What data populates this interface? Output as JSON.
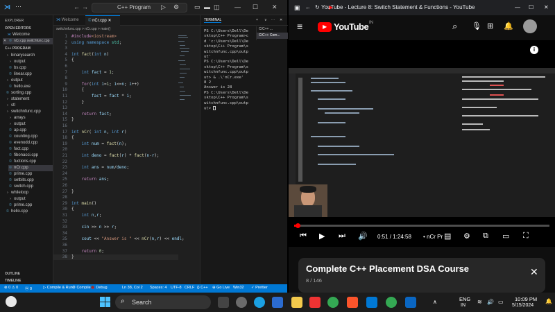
{
  "vscode": {
    "title": "C++ Program",
    "explorer": {
      "header": "EXPLORER",
      "open_editors": "OPEN EDITORS",
      "open_items": [
        "Welcome",
        "nCr.cpp switchfunc.cpp"
      ],
      "folder": "C++ PROGRAM",
      "items": [
        {
          "label": "binarysearch",
          "kind": "folder"
        },
        {
          "label": "output",
          "kind": "folder"
        },
        {
          "label": "bs.cpp",
          "kind": "file"
        },
        {
          "label": "linear.cpp",
          "kind": "file"
        },
        {
          "label": "output",
          "kind": "folder"
        },
        {
          "label": "hello.exe",
          "kind": "file"
        },
        {
          "label": "sorting.cpp",
          "kind": "file"
        },
        {
          "label": "statement",
          "kind": "folder"
        },
        {
          "label": "stl",
          "kind": "folder"
        },
        {
          "label": "switchnfunc.cpp",
          "kind": "folder"
        },
        {
          "label": "arrays",
          "kind": "folder"
        },
        {
          "label": "output",
          "kind": "folder"
        },
        {
          "label": "ap.cpp",
          "kind": "file"
        },
        {
          "label": "counting.cpp",
          "kind": "file"
        },
        {
          "label": "evenodd.cpp",
          "kind": "file"
        },
        {
          "label": "fact.cpp",
          "kind": "file"
        },
        {
          "label": "fibonacci.cpp",
          "kind": "file"
        },
        {
          "label": "fuctions.cpp",
          "kind": "file"
        },
        {
          "label": "nCr.cpp",
          "kind": "file"
        },
        {
          "label": "prime.cpp",
          "kind": "file"
        },
        {
          "label": "setbits.cpp",
          "kind": "file"
        },
        {
          "label": "switch.cpp",
          "kind": "file"
        },
        {
          "label": "whileloop",
          "kind": "folder"
        },
        {
          "label": "output",
          "kind": "folder"
        },
        {
          "label": "prime.cpp",
          "kind": "file"
        },
        {
          "label": "hello.cpp",
          "kind": "file"
        }
      ],
      "outline": "OUTLINE",
      "timeline": "TIMELINE"
    },
    "tabs": [
      "Welcome",
      "nCr.cpp"
    ],
    "breadcrumb": "switchnfunc.cpp  >  nCr.cpp  >  main()",
    "code": [
      [
        [
          "pp",
          "#include"
        ],
        [
          "st",
          "<iostream>"
        ]
      ],
      [
        [
          "kw",
          "using namespace "
        ],
        [
          "ty",
          "std"
        ],
        [
          "tx",
          ";"
        ]
      ],
      [],
      [
        [
          "kw",
          "int "
        ],
        [
          "fn",
          "fact"
        ],
        [
          "tx",
          "("
        ],
        [
          "kw",
          "int "
        ],
        [
          "vr",
          "n"
        ],
        [
          "tx",
          ")"
        ]
      ],
      [
        [
          "tx",
          "{"
        ]
      ],
      [],
      [
        [
          "tx",
          "    "
        ],
        [
          "kw",
          "int "
        ],
        [
          "vr",
          "fact"
        ],
        [
          "tx",
          " = "
        ],
        [
          "nm",
          "1"
        ],
        [
          "tx",
          ";"
        ]
      ],
      [],
      [
        [
          "tx",
          "    "
        ],
        [
          "pp",
          "for"
        ],
        [
          "tx",
          "("
        ],
        [
          "kw",
          "int "
        ],
        [
          "vr",
          "i"
        ],
        [
          "tx",
          "="
        ],
        [
          "nm",
          "1"
        ],
        [
          "tx",
          "; "
        ],
        [
          "vr",
          "i"
        ],
        [
          "tx",
          "<="
        ],
        [
          "vr",
          "n"
        ],
        [
          "tx",
          "; "
        ],
        [
          "vr",
          "i"
        ],
        [
          "tx",
          "++)"
        ]
      ],
      [
        [
          "tx",
          "    {"
        ]
      ],
      [
        [
          "tx",
          "        "
        ],
        [
          "vr",
          "fact"
        ],
        [
          "tx",
          " = "
        ],
        [
          "vr",
          "fact"
        ],
        [
          "tx",
          " * "
        ],
        [
          "vr",
          "i"
        ],
        [
          "tx",
          ";"
        ]
      ],
      [
        [
          "tx",
          "    }"
        ]
      ],
      [],
      [
        [
          "tx",
          "    "
        ],
        [
          "pp",
          "return "
        ],
        [
          "vr",
          "fact"
        ],
        [
          "tx",
          ";"
        ]
      ],
      [
        [
          "tx",
          "}"
        ]
      ],
      [],
      [
        [
          "kw",
          "int "
        ],
        [
          "fn",
          "nCr"
        ],
        [
          "tx",
          "( "
        ],
        [
          "kw",
          "int "
        ],
        [
          "vr",
          "n"
        ],
        [
          "tx",
          ", "
        ],
        [
          "kw",
          "int "
        ],
        [
          "vr",
          "r"
        ],
        [
          "tx",
          ")"
        ]
      ],
      [
        [
          "tx",
          "{"
        ]
      ],
      [
        [
          "tx",
          "    "
        ],
        [
          "kw",
          "int "
        ],
        [
          "vr",
          "num"
        ],
        [
          "tx",
          " = "
        ],
        [
          "fn",
          "fact"
        ],
        [
          "tx",
          "("
        ],
        [
          "vr",
          "n"
        ],
        [
          "tx",
          ");"
        ]
      ],
      [],
      [
        [
          "tx",
          "    "
        ],
        [
          "kw",
          "int "
        ],
        [
          "vr",
          "deno"
        ],
        [
          "tx",
          " = "
        ],
        [
          "fn",
          "fact"
        ],
        [
          "tx",
          "("
        ],
        [
          "vr",
          "r"
        ],
        [
          "tx",
          ") * "
        ],
        [
          "fn",
          "fact"
        ],
        [
          "tx",
          "("
        ],
        [
          "vr",
          "n"
        ],
        [
          "tx",
          "-"
        ],
        [
          "vr",
          "r"
        ],
        [
          "tx",
          ");"
        ]
      ],
      [],
      [
        [
          "tx",
          "    "
        ],
        [
          "kw",
          "int "
        ],
        [
          "vr",
          "ans"
        ],
        [
          "tx",
          " = "
        ],
        [
          "vr",
          "num"
        ],
        [
          "tx",
          "/"
        ],
        [
          "vr",
          "deno"
        ],
        [
          "tx",
          ";"
        ]
      ],
      [],
      [
        [
          "tx",
          "    "
        ],
        [
          "pp",
          "return "
        ],
        [
          "vr",
          "ans"
        ],
        [
          "tx",
          ";"
        ]
      ],
      [],
      [
        [
          "tx",
          "}"
        ]
      ],
      [],
      [
        [
          "kw",
          "int "
        ],
        [
          "fn",
          "main"
        ],
        [
          "tx",
          "()"
        ]
      ],
      [
        [
          "tx",
          "{"
        ]
      ],
      [
        [
          "tx",
          "    "
        ],
        [
          "kw",
          "int "
        ],
        [
          "vr",
          "n"
        ],
        [
          "tx",
          ","
        ],
        [
          "vr",
          "r"
        ],
        [
          "tx",
          ";"
        ]
      ],
      [],
      [
        [
          "tx",
          "    "
        ],
        [
          "vr",
          "cin"
        ],
        [
          "tx",
          " >> "
        ],
        [
          "vr",
          "n"
        ],
        [
          "tx",
          " >> "
        ],
        [
          "vr",
          "r"
        ],
        [
          "tx",
          ";"
        ]
      ],
      [],
      [
        [
          "tx",
          "    "
        ],
        [
          "vr",
          "cout"
        ],
        [
          "tx",
          " << "
        ],
        [
          "st",
          "\"Answer is \""
        ],
        [
          "tx",
          " << "
        ],
        [
          "fn",
          "nCr"
        ],
        [
          "tx",
          "("
        ],
        [
          "vr",
          "n"
        ],
        [
          "tx",
          ","
        ],
        [
          "vr",
          "r"
        ],
        [
          "tx",
          ") << "
        ],
        [
          "vr",
          "endl"
        ],
        [
          "tx",
          ";"
        ]
      ],
      [],
      [
        [
          "tx",
          "    "
        ],
        [
          "pp",
          "return "
        ],
        [
          "nm",
          "0"
        ],
        [
          "tx",
          ";"
        ]
      ],
      [
        [
          "tx",
          "}"
        ]
      ]
    ],
    "terminal": {
      "tab": "TERMINAL",
      "sessions": [
        "C/C++ ...",
        "C/C++ Com..."
      ],
      "lines": [
        "PS C:\\Users\\Dell\\De",
        "sktop\\C++ Program>c",
        "d 'c:\\Users\\Dell\\De",
        "sktop\\C++ Program\\s",
        "witchnfunc.cpp\\outp",
        "ut'",
        "PS C:\\Users\\Dell\\De",
        "sktop\\C++ Program\\s",
        "witchnfunc.cpp\\outp",
        "ut> & .\\'nCr.exe'",
        "8 2",
        "Answer is 28",
        "PS C:\\Users\\Dell\\De",
        "sktop\\C++ Program\\s",
        "witchnfunc.cpp\\outp",
        "ut> "
      ]
    },
    "status": [
      "⊗ 0 ⚠ 0",
      "ⓦ 0",
      "▷ Compile & Run",
      "⚙ Compile",
      "🐞 Debug",
      "Ln 38, Col 2",
      "Spaces: 4",
      "UTF-8",
      "CRLF",
      "{} C++",
      "⊕ Go Live",
      "Win32",
      "✓ Prettier"
    ]
  },
  "browser": {
    "title": "YouTube - Lecture 8: Switch Statement & Functions - YouTube",
    "logo": "YouTube",
    "region": "IN",
    "time": "0:51 / 1:24:58",
    "chapter": "• nCr Pr",
    "progress": 0.01,
    "course_title": "Complete C++ Placement DSA Course",
    "course_count": "8 / 146"
  },
  "taskbar": {
    "search": "Search",
    "lang": "ENG",
    "region": "IN",
    "time": "10:09 PM",
    "date": "5/15/2024"
  }
}
